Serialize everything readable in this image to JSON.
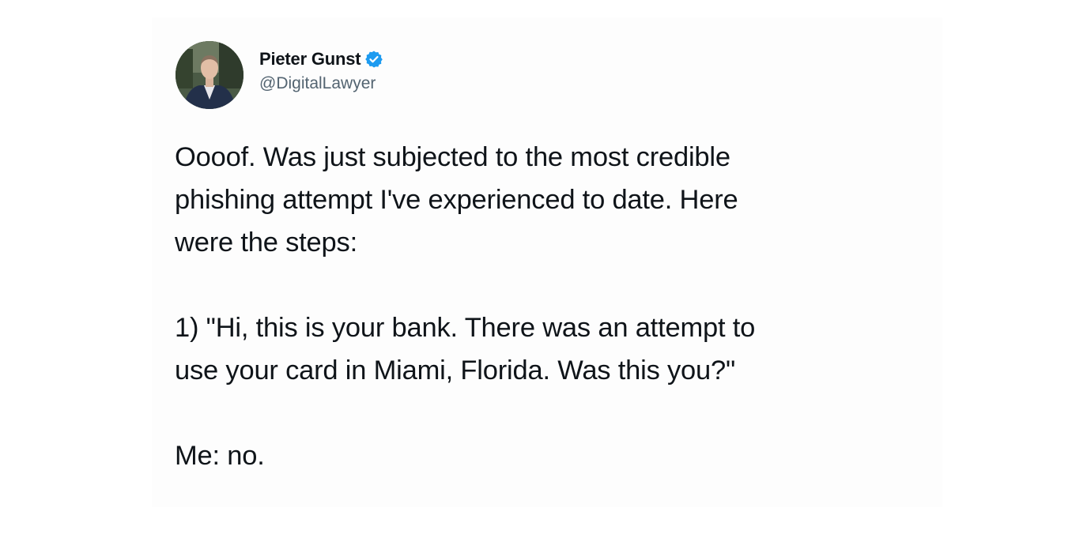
{
  "author": {
    "display_name": "Pieter Gunst",
    "handle": "@DigitalLawyer",
    "verified": true,
    "avatar_icon": "profile-photo-man-in-suit",
    "verified_icon": "verified-badge-icon",
    "verified_color": "#1d9bf0"
  },
  "tweet": {
    "paragraphs": [
      "Oooof. Was just subjected to the most credible\nphishing attempt I've experienced to date. Here\nwere the steps:",
      "1) \"Hi, this is your bank. There was an attempt to\nuse your card in Miami, Florida. Was this you?\"",
      "Me: no."
    ]
  }
}
